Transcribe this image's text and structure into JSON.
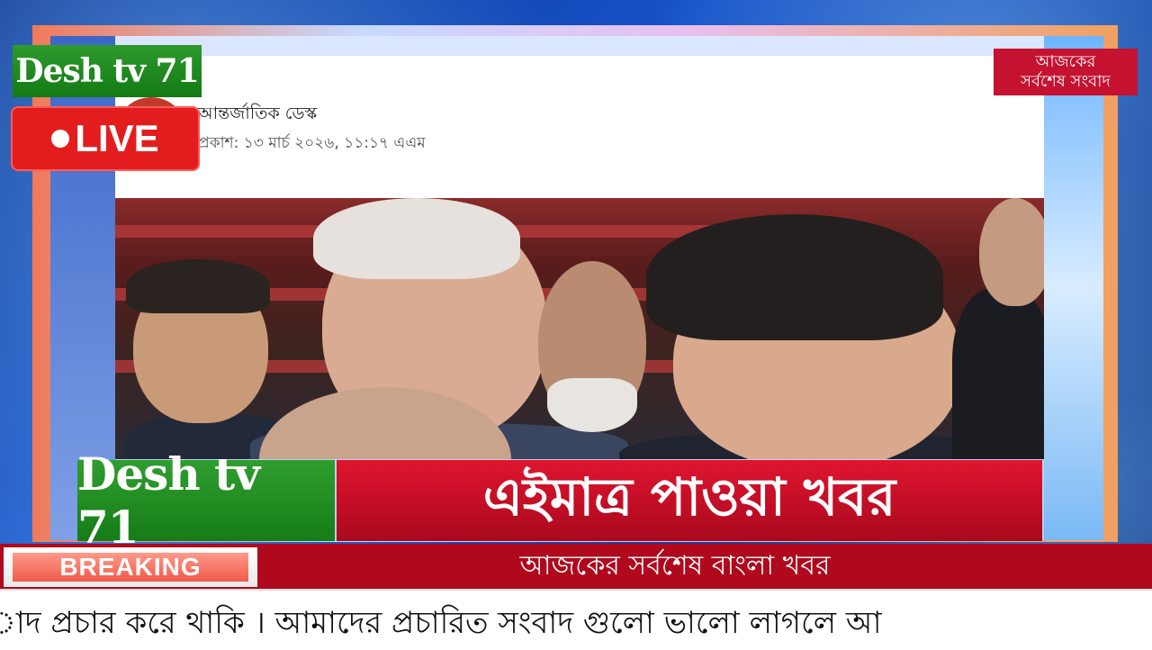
{
  "channel": {
    "name_top": "Desh tv 71",
    "name_bottom": "Desh tv 71",
    "live_label": "LIVE",
    "corner_badge_line1": "আজকের",
    "corner_badge_line2": "সর্বশেষ সংবাদ"
  },
  "article": {
    "author": "আন্তর্জাতিক ডেস্ক",
    "published": "প্রকাশ: ১৩ মার্চ ২০২৬, ১১:১৭ এএম"
  },
  "lower_third": {
    "headline": "এইমাত্র পাওয়া খবর",
    "breaking_label": "BREAKING",
    "subheadline": "আজকের সর্বশেষ বাংলা খবর",
    "ticker_text": "াদ প্রচার করে থাকি । আমাদের প্রচারিত সংবাদ গুলো ভালো লাগলে আ"
  },
  "colors": {
    "brand_green": "#1a841a",
    "live_red": "#e31d1d",
    "headline_red": "#c80f26",
    "background_blue": "#0b2f8a"
  }
}
